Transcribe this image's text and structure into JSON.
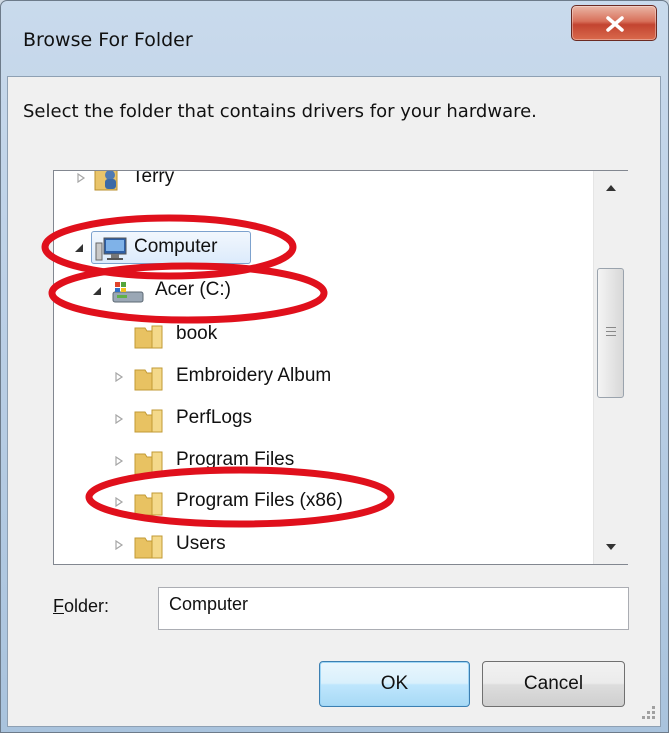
{
  "window": {
    "title": "Browse For Folder"
  },
  "instruction": "Select the folder that contains drivers for your hardware.",
  "tree": {
    "items": [
      {
        "label": "Terry",
        "expanded": false,
        "icon": "user-folder-icon"
      },
      {
        "label": "Computer",
        "expanded": true,
        "selected": true,
        "icon": "computer-icon"
      },
      {
        "label": "Acer (C:)",
        "expanded": true,
        "icon": "drive-icon"
      },
      {
        "label": "book",
        "expanded": false,
        "icon": "folder-icon"
      },
      {
        "label": "Embroidery Album",
        "expanded": false,
        "icon": "folder-icon"
      },
      {
        "label": "PerfLogs",
        "expanded": false,
        "icon": "folder-icon"
      },
      {
        "label": "Program Files",
        "expanded": false,
        "icon": "folder-icon"
      },
      {
        "label": "Program Files (x86)",
        "expanded": false,
        "icon": "folder-icon"
      },
      {
        "label": "Users",
        "expanded": false,
        "icon": "folder-icon"
      }
    ]
  },
  "folder": {
    "label_first": "F",
    "label_rest": "older:",
    "value": "Computer"
  },
  "buttons": {
    "ok": "OK",
    "cancel": "Cancel"
  },
  "colors": {
    "annotation": "#e0101c",
    "selection": "#dcebfc",
    "close": "#c94a36"
  }
}
